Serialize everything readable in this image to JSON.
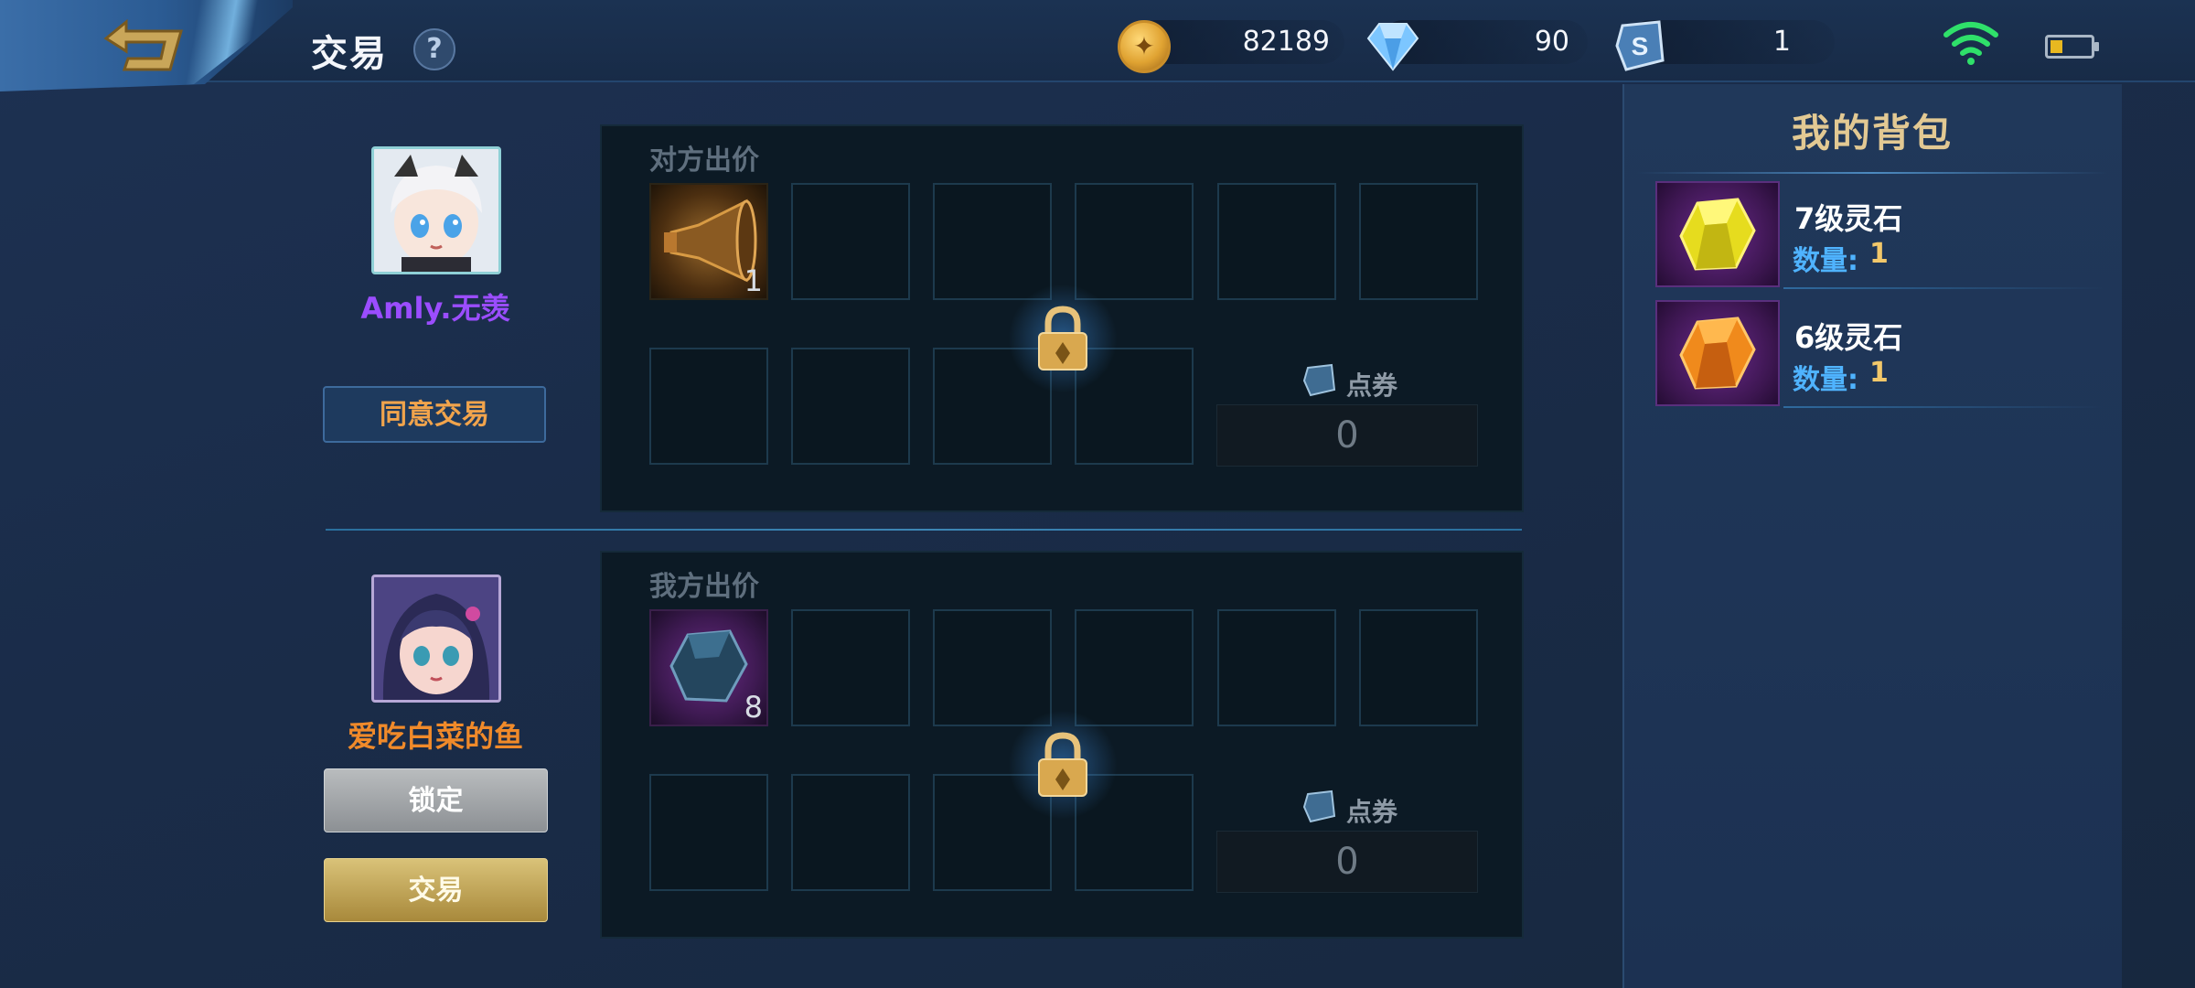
{
  "header": {
    "title": "交易",
    "help_glyph": "?"
  },
  "currencies": {
    "gold": "82189",
    "diamonds": "90",
    "vouchers": "1"
  },
  "status": {
    "wifi": "wifi-icon",
    "battery_level": 0.3
  },
  "opponent": {
    "name": "Amly.无羡",
    "name_color": "#9b4dff",
    "agree_label": "同意交易",
    "offer_title": "对方出价",
    "items": [
      {
        "type": "horn",
        "count": "1"
      }
    ],
    "voucher_label": "点券",
    "voucher_value": "0"
  },
  "me": {
    "name": "爱吃白菜的鱼",
    "name_color": "#f08a2a",
    "lock_label": "锁定",
    "trade_label": "交易",
    "offer_title": "我方出价",
    "items": [
      {
        "type": "gem",
        "count": "8"
      }
    ],
    "voucher_label": "点券",
    "voucher_value": "0"
  },
  "backpack": {
    "title": "我的背包",
    "qty_label": "数量:",
    "items": [
      {
        "name": "7级灵石",
        "qty": "1",
        "color": "yellow"
      },
      {
        "name": "6级灵石",
        "qty": "1",
        "color": "orange"
      }
    ]
  },
  "colors": {
    "accent_gold": "#e2c993",
    "button_gold": "#c7ab5a",
    "qty_blue": "#4fb3ff"
  }
}
